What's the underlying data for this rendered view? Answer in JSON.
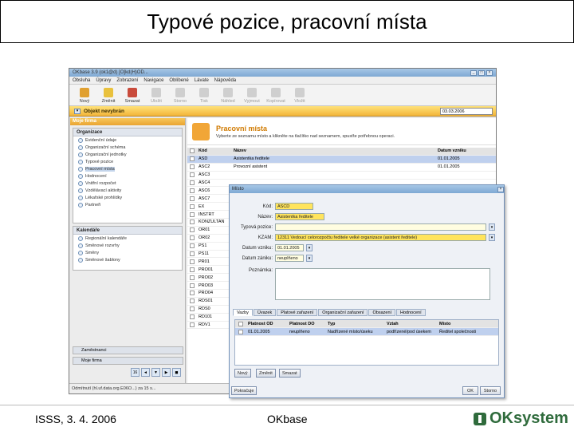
{
  "slide": {
    "title": "Typové pozice, pracovní místa",
    "footer_left": "ISSS, 3. 4. 2006",
    "footer_center": "OKbase",
    "logo_text": "OKsystem"
  },
  "app": {
    "window_title": "OKbase 3.9 (ok1@d) [O]kd(H)OD...",
    "menu": [
      "Obsluha",
      "Úpravy",
      "Zobrazení",
      "Navigace",
      "Oblíbené",
      "Lávate",
      "Nápověda"
    ],
    "toolbar": [
      {
        "label": "Nový",
        "enabled": true,
        "color": "#e0a030"
      },
      {
        "label": "Změnit",
        "enabled": true,
        "color": "#e9c13d"
      },
      {
        "label": "Smazat",
        "enabled": true,
        "color": "#c94b3b"
      },
      {
        "label": "Uložit",
        "enabled": false
      },
      {
        "label": "Storno",
        "enabled": false
      },
      {
        "label": "Tisk",
        "enabled": false
      },
      {
        "label": "Náhled",
        "enabled": false
      },
      {
        "label": "Vyjmout",
        "enabled": false
      },
      {
        "label": "Kopírovat",
        "enabled": false
      },
      {
        "label": "Vložit",
        "enabled": false
      }
    ],
    "object_label": "Objekt nevybrán",
    "date_value": "03.03.2006",
    "sidebar": {
      "header": "Moje firma",
      "org_panel_title": "Organizace",
      "org_items": [
        "Evidenční údaje",
        "Organizační schéma",
        "Organizační jednotky",
        "Typové pozice",
        "Pracovní místa",
        "Hodnocení",
        "Vnitřní rozpočet",
        "Vzdělávací aktivity",
        "Lékařské prohlídky",
        "Partneři"
      ],
      "org_selected_index": 4,
      "cal_panel_title": "Kalendáře",
      "cal_items": [
        "Regionální kalendáře",
        "Směnové rozvrhy",
        "Směny",
        "Směnové šablony"
      ],
      "bottom_items": [
        "Zaměstnanci",
        "Moje firma"
      ],
      "pager": [
        "16",
        "◄",
        "▼",
        "▶",
        "◼"
      ]
    },
    "main": {
      "title": "Pracovní místa",
      "desc": "Vyberte ze seznamu místo a klikněte na tlačítko nad seznamem, spusťte potřebnou operaci.",
      "columns": [
        "Kód",
        "Název",
        "Datum vzniku"
      ],
      "rows": [
        {
          "code": "ASD",
          "name": "Asistentka ředitele",
          "date": "01.01.2005",
          "sel": true
        },
        {
          "code": "ASC2",
          "name": "Provozní asistent",
          "date": "01.01.2005",
          "sel": false
        },
        {
          "code": "ASC3",
          "name": "",
          "date": "",
          "sel": false
        },
        {
          "code": "ASC4",
          "name": "",
          "date": "",
          "sel": false
        },
        {
          "code": "ASC6",
          "name": "",
          "date": "",
          "sel": false
        },
        {
          "code": "ASC7",
          "name": "",
          "date": "",
          "sel": false
        },
        {
          "code": "EX",
          "name": "",
          "date": "",
          "sel": false
        },
        {
          "code": "INSTRT",
          "name": "",
          "date": "",
          "sel": false
        },
        {
          "code": "KONZULTAN",
          "name": "",
          "date": "",
          "sel": false
        },
        {
          "code": "OR01",
          "name": "",
          "date": "",
          "sel": false
        },
        {
          "code": "OR02",
          "name": "",
          "date": "",
          "sel": false
        },
        {
          "code": "PS1",
          "name": "",
          "date": "",
          "sel": false
        },
        {
          "code": "PS11",
          "name": "",
          "date": "",
          "sel": false
        },
        {
          "code": "PR01",
          "name": "",
          "date": "",
          "sel": false
        },
        {
          "code": "PRO01",
          "name": "",
          "date": "",
          "sel": false
        },
        {
          "code": "PRO02",
          "name": "",
          "date": "",
          "sel": false
        },
        {
          "code": "PRO03",
          "name": "",
          "date": "",
          "sel": false
        },
        {
          "code": "PRO04",
          "name": "",
          "date": "",
          "sel": false
        },
        {
          "code": "RDS01",
          "name": "",
          "date": "",
          "sel": false
        },
        {
          "code": "RDS0",
          "name": "",
          "date": "",
          "sel": false
        },
        {
          "code": "RD101",
          "name": "",
          "date": "",
          "sel": false
        },
        {
          "code": "RDV1",
          "name": "",
          "date": "",
          "sel": false
        }
      ]
    },
    "status_text": "Odmítnutí (hl.uf.data.org.E06O...) za 15 s..."
  },
  "dialog": {
    "title": "Místo",
    "fields": {
      "kod_label": "Kód:",
      "kod_value": "ASCD",
      "nazev_label": "Název:",
      "nazev_value": "Asistentka ředitele",
      "typova_label": "Typová pozice:",
      "typova_value": "",
      "kzam_label": "KZAM:",
      "kzam_value": "12311   Vedoucí celorozpočtu ředitele velké organizace (asistent ředitele)",
      "datum_vzniku_label": "Datum vzniku:",
      "datum_vzniku_value": "01.01.2005",
      "datum_zaniku_label": "Datum zániku:",
      "datum_zaniku_value": "neuplňeno",
      "poznamka_label": "Poznámka:"
    },
    "tabs": [
      "Vazby",
      "Úvazek",
      "Platové zařazení",
      "Organizační zařazení",
      "Obsazení",
      "Hodnocení"
    ],
    "active_tab": 0,
    "sub_columns": [
      "Platnost OD",
      "Platnost DO",
      "Typ",
      "Vztah",
      "Místo"
    ],
    "sub_rows": [
      {
        "od": "01.01.2005",
        "do": "neuplňeno",
        "typ": "Nadřízené místo/úseku",
        "vztah": "podřízené/pod úsekem",
        "misto": "Ředitel společnosti"
      }
    ],
    "sub_buttons": [
      "Nový",
      "Změnit",
      "Smazat"
    ],
    "bottom_left_button": "Pokračuje",
    "ok_button": "OK",
    "storno_button": "Storno"
  }
}
